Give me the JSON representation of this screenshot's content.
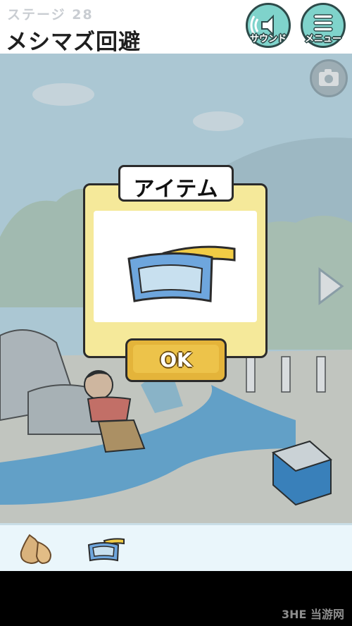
{
  "header": {
    "stage_label": "ステージ 28",
    "stage_title": "メシマズ回避",
    "sound_label": "サウンド",
    "menu_label": "メニュー"
  },
  "modal": {
    "title": "アイテム",
    "ok_label": "OK",
    "item_icon": "swim-goggles-icon"
  },
  "inventory": {
    "items": [
      {
        "icon": "onion-icon"
      },
      {
        "icon": "swim-goggles-icon"
      }
    ]
  },
  "watermark": "3HE 当游网",
  "colors": {
    "accent": "#7fd3cb",
    "modal_bg": "#f5e99a",
    "ok_button": "#e4b43a",
    "sky": "#c9e6f2"
  }
}
